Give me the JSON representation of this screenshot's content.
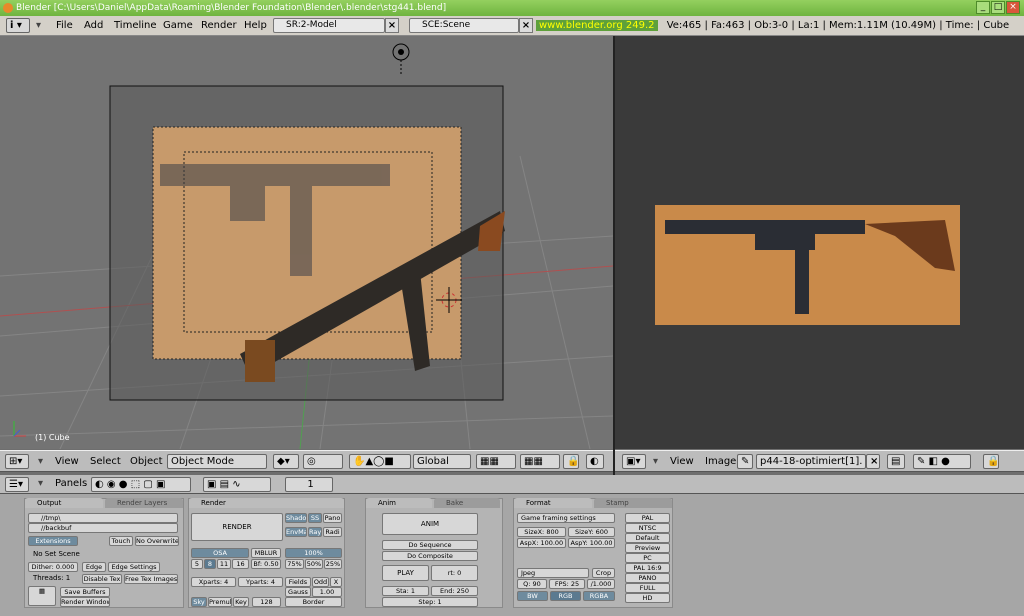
{
  "titlebar": {
    "title": "Blender [C:\\Users\\Daniel\\AppData\\Roaming\\Blender Foundation\\Blender\\.blender\\stg441.blend]"
  },
  "menubar": {
    "menus": [
      "File",
      "Add",
      "Timeline",
      "Game",
      "Render",
      "Help"
    ],
    "screen": "SR:2-Model",
    "scene": "SCE:Scene",
    "url": "www.blender.org 249.2",
    "stats": "Ve:465 | Fa:463 | Ob:3-0 | La:1  | Mem:1.11M (10.49M)  | Time: | Cube"
  },
  "viewport": {
    "object_label": "(1) Cube"
  },
  "view3d_header": {
    "menus": [
      "View",
      "Select",
      "Object"
    ],
    "mode": "Object Mode",
    "orientation": "Global"
  },
  "image_header": {
    "menus": [
      "View",
      "Image"
    ],
    "image_name": "p44-18-optimiert[1]."
  },
  "buttons_header": {
    "panels_label": "Panels",
    "frame": "1"
  },
  "output_panel": {
    "tabs": [
      "Output",
      "Render Layers"
    ],
    "paths": [
      "//tmp\\",
      "//backbuf"
    ],
    "extensions": "Extensions",
    "touch": "Touch",
    "no_overwrite": "No Overwrite",
    "no_set_scene": "No Set Scene",
    "dither": "Dither: 0.000",
    "edge": "Edge",
    "edge_settings": "Edge Settings",
    "threads": "Threads: 1",
    "disable_tex": "Disable Tex",
    "free_tex": "Free Tex Images",
    "save_buffers": "Save Buffers",
    "render_window": "Render Window"
  },
  "render_panel": {
    "tabs": [
      "Render"
    ],
    "render": "RENDER",
    "shadow": "Shado",
    "ss": "SS",
    "pano": "Pano",
    "envmap": "EnvMa",
    "ray": "Ray",
    "radio": "Radi",
    "osa": "OSA",
    "mblur": "MBLUR",
    "percent": "100%",
    "osa_values": [
      "5",
      "8",
      "11",
      "16"
    ],
    "bf": "Bf: 0.50",
    "sizes": [
      "75%",
      "50%",
      "25%"
    ],
    "xparts": "Xparts: 4",
    "yparts": "Yparts: 4",
    "fields": "Fields",
    "odd": "Odd",
    "x": "X",
    "gauss": "Gauss",
    "gauss_val": "1.00",
    "sky": "Sky",
    "premul": "Premul",
    "key": "Key",
    "bits": "128",
    "border": "Border"
  },
  "anim_panel": {
    "tabs": [
      "Anim",
      "Bake"
    ],
    "anim": "ANIM",
    "do_sequence": "Do Sequence",
    "do_composite": "Do Composite",
    "play": "PLAY",
    "rt": "rt: 0",
    "sta": "Sta: 1",
    "end": "End: 250",
    "step": "Step: 1"
  },
  "format_panel": {
    "tabs": [
      "Format",
      "Stamp"
    ],
    "game_framing": "Game framing settings",
    "sizex": "SizeX: 800",
    "sizey": "SizeY: 600",
    "aspx": "AspX: 100.00",
    "aspy": "AspY: 100.00",
    "format": "Jpeg",
    "crop": "Crop",
    "quality": "Q: 90",
    "fps": "FPS: 25",
    "fps_base": "/1.000",
    "bw": "BW",
    "rgb": "RGB",
    "rgba": "RGBA",
    "presets": [
      "PAL",
      "NTSC",
      "Default",
      "Preview",
      "PC",
      "PAL 16:9",
      "PANO",
      "FULL",
      "HD"
    ]
  },
  "colors": {
    "titlebar": "#7bbd4a",
    "ui_gray": "#b4b4b4",
    "viewport": "#737373",
    "accent": "#6e8b9e"
  }
}
